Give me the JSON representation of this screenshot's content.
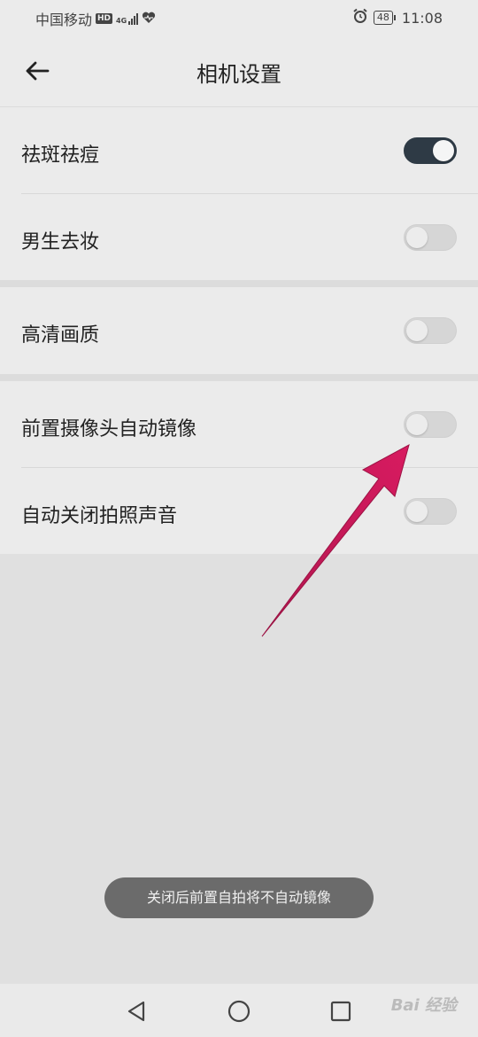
{
  "status_bar": {
    "carrier": "中国移动",
    "hd_badge": "HD",
    "network": "4G",
    "battery": "48",
    "time": "11:08",
    "icons": [
      "signal-icon",
      "heart-icon",
      "alarm-icon",
      "battery-icon"
    ]
  },
  "header": {
    "title": "相机设置",
    "back_icon": "back-arrow-icon"
  },
  "settings": [
    {
      "label": "祛斑祛痘",
      "on": true
    },
    {
      "label": "男生去妆",
      "on": false
    },
    {
      "label": "高清画质",
      "on": false
    },
    {
      "label": "前置摄像头自动镜像",
      "on": false
    },
    {
      "label": "自动关闭拍照声音",
      "on": false
    }
  ],
  "toast": "关闭后前置自拍将不自动镜像",
  "nav": [
    "back-triangle-icon",
    "home-circle-icon",
    "recents-square-icon"
  ],
  "watermark": "Bai 经验",
  "colors": {
    "toggle_on": "#2e3a45",
    "annotation_arrow": "#c2185b"
  }
}
